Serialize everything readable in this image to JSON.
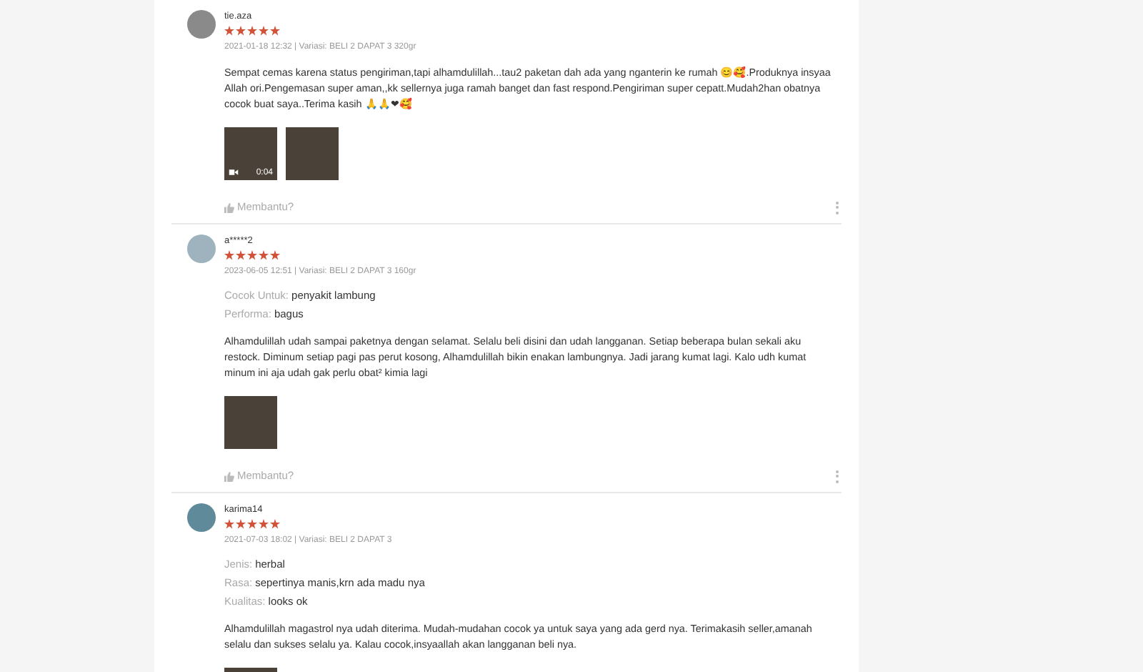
{
  "reviews": [
    {
      "username": "tie.aza",
      "stars": 5,
      "meta": "2021-01-18 12:32 | Variasi: BELI 2 DAPAT 3 320gr",
      "text": "Sempat cemas karena status pengiriman,tapi alhamdulillah...tau2 paketan dah ada yang nganterin ke rumah 😊🥰.Produknya insyaa Allah ori.Pengemasan super aman,,kk sellernya juga ramah banget dan fast respond.Pengiriman super cepatt.Mudah2han obatnya cocok buat saya..Terima kasih 🙏🙏❤🥰",
      "media": [
        {
          "kind": "video",
          "duration": "0:04"
        },
        {
          "kind": "photo"
        }
      ],
      "helpful": "Membantu?"
    },
    {
      "username": "a*****2",
      "stars": 5,
      "meta": "2023-06-05 12:51 | Variasi: BELI 2 DAPAT 3 160gr",
      "attributes": [
        {
          "label": "Cocok Untuk:",
          "value": "penyakit lambung"
        },
        {
          "label": "Performa:",
          "value": "bagus"
        }
      ],
      "text": "Alhamdulillah udah sampai paketnya dengan selamat. Selalu beli disini dan udah langganan. Setiap beberapa bulan sekali aku restock. Diminum setiap pagi pas perut kosong, Alhamdulillah bikin enakan lambungnya. Jadi jarang kumat lagi. Kalo udh kumat minum ini aja udah gak perlu obat² kimia lagi",
      "media": [
        {
          "kind": "photo"
        }
      ],
      "helpful": "Membantu?"
    },
    {
      "username": "karima14",
      "stars": 5,
      "meta": "2021-07-03 18:02 | Variasi: BELI 2 DAPAT 3",
      "attributes": [
        {
          "label": "Jenis:",
          "value": "herbal"
        },
        {
          "label": "Rasa:",
          "value": "sepertinya manis,krn ada madu nya"
        },
        {
          "label": "Kualitas:",
          "value": "looks ok"
        }
      ],
      "text": "Alhamdulillah magastrol nya udah diterima. Mudah-mudahan cocok ya untuk saya yang ada gerd nya. Terimakasih seller,amanah selalu dan sukses selalu ya. Kalau cocok,insyaallah akan langganan beli nya.",
      "media": [
        {
          "kind": "photo"
        }
      ]
    }
  ]
}
